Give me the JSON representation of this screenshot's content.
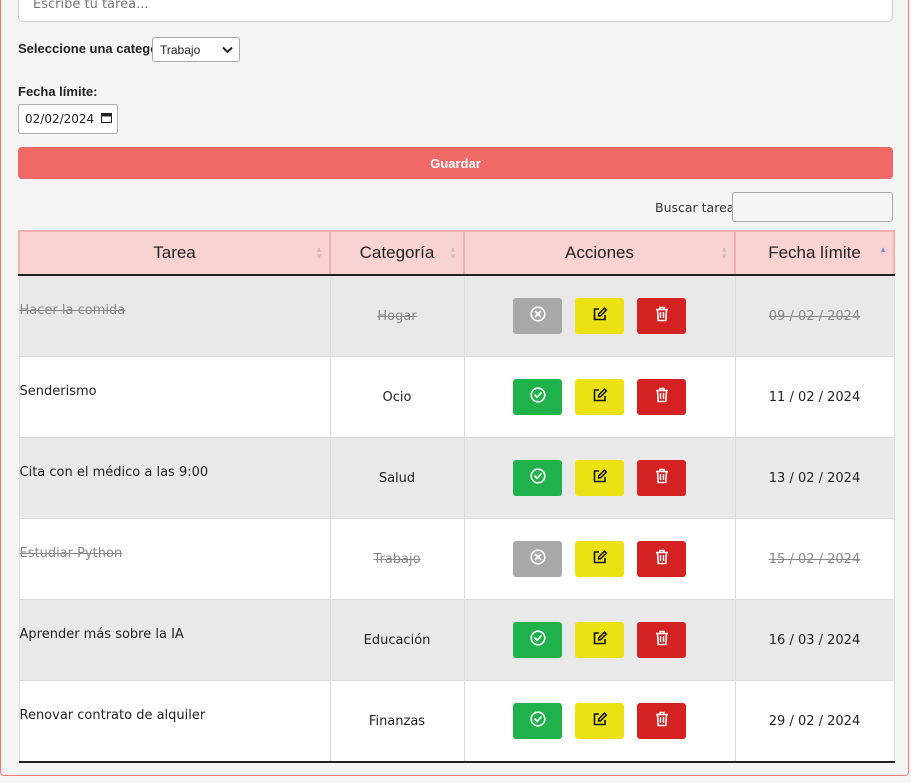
{
  "form": {
    "task_placeholder": "Escribe tu tarea...",
    "category_label": "Seleccione una categoría",
    "category_selected": "Trabajo",
    "date_label": "Fecha límite:",
    "date_value": "02/02/2024",
    "save_label": "Guardar"
  },
  "search": {
    "label": "Buscar tarea:"
  },
  "table": {
    "headers": {
      "task": "Tarea",
      "category": "Categoría",
      "actions": "Acciones",
      "date": "Fecha límite"
    },
    "rows": [
      {
        "task": "Hacer la comida",
        "category": "Hogar",
        "date": "09 / 02 / 2024",
        "completed": true
      },
      {
        "task": "Senderismo",
        "category": "Ocio",
        "date": "11 / 02 / 2024",
        "completed": false
      },
      {
        "task": "Cita con el médico a las 9:00",
        "category": "Salud",
        "date": "13 / 02 / 2024",
        "completed": false
      },
      {
        "task": "Estudiar Python",
        "category": "Trabajo",
        "date": "15 / 02 / 2024",
        "completed": true
      },
      {
        "task": "Aprender más sobre la IA",
        "category": "Educación",
        "date": "16 / 03 / 2024",
        "completed": false
      },
      {
        "task": "Renovar contrato de alquiler",
        "category": "Finanzas",
        "date": "29 / 02 / 2024",
        "completed": false
      }
    ]
  },
  "icons": {
    "complete": "check-circle-icon",
    "undo": "x-circle-icon",
    "edit": "edit-icon",
    "delete": "trash-icon",
    "sort": "sort-arrows-icon",
    "calendar": "calendar-icon",
    "dropdown": "chevron-down-icon"
  },
  "colors": {
    "accent": "#ef6a67",
    "header_bg": "#f8d3d2",
    "complete_button": "#1fb24a",
    "undo_button": "#a8a8a8",
    "edit_button": "#ece213",
    "delete_button": "#d42121"
  }
}
